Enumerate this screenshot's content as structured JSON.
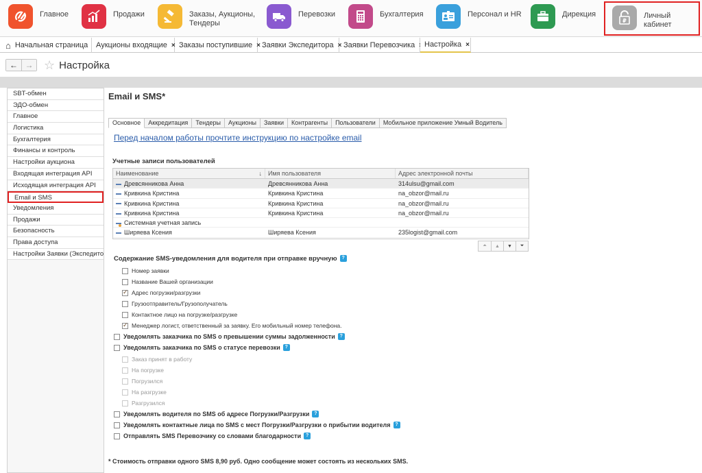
{
  "sections": [
    {
      "label": "Главное",
      "color": "#f0532d",
      "icon": "logo-icon"
    },
    {
      "label": "Продажи",
      "color": "#e03244",
      "icon": "sales-chart-icon"
    },
    {
      "label": "Заказы,  Аукционы,\nТендеры",
      "color": "#f5b935",
      "icon": "gavel-icon"
    },
    {
      "label": "Перевозки",
      "color": "#8a5ad0",
      "icon": "truck-icon"
    },
    {
      "label": "Бухгалтерия",
      "color": "#c24a8a",
      "icon": "calculator-icon"
    },
    {
      "label": "Персонал и HR",
      "color": "#3aa0dc",
      "icon": "id-card-icon"
    },
    {
      "label": "Дирекция",
      "color": "#2e9a52",
      "icon": "briefcase-icon"
    },
    {
      "label": "Личный кабинет",
      "color": "#999999",
      "icon": "lock-ruble-icon"
    }
  ],
  "open_tabs": [
    {
      "label": "Начальная страница"
    },
    {
      "label": "Аукционы входящие"
    },
    {
      "label": "Заказы поступившие"
    },
    {
      "label": "Заявки Экспедитора"
    },
    {
      "label": "Заявки Перевозчика"
    },
    {
      "label": "Настройка"
    }
  ],
  "page": {
    "title": "Настройка"
  },
  "sidebar": {
    "items": [
      {
        "label": "SBT-обмен"
      },
      {
        "label": "ЭДО-обмен"
      },
      {
        "label": "Главное"
      },
      {
        "label": "Логистика"
      },
      {
        "label": "Бухгалтерия"
      },
      {
        "label": "Финансы и контроль"
      },
      {
        "label": "Настройки аукциона"
      },
      {
        "label": "Входящая интеграция API"
      },
      {
        "label": "Исходящая интеграция API"
      },
      {
        "label": "Email и SMS"
      },
      {
        "label": "Уведомления"
      },
      {
        "label": "Продажи"
      },
      {
        "label": "Безопасность"
      },
      {
        "label": "Права доступа"
      },
      {
        "label": "Настройки Заявки (Экспедитора)"
      }
    ],
    "selected_index": 9
  },
  "main": {
    "heading": "Email и SMS*",
    "tabs": [
      {
        "label": "Основное"
      },
      {
        "label": "Аккредитация"
      },
      {
        "label": "Тендеры"
      },
      {
        "label": "Аукционы"
      },
      {
        "label": "Заявки"
      },
      {
        "label": "Контрагенты"
      },
      {
        "label": "Пользователи"
      },
      {
        "label": "Мобильное приложение Умный Водитель"
      }
    ],
    "intro_link": "Перед началом работы прочтите инструкцию по настройке email",
    "accounts_label": "Учетные записи пользователей",
    "table": {
      "columns": [
        "Наименование",
        "Имя пользователя",
        "Адрес электронной почты"
      ],
      "sort_indicator": "↓",
      "rows": [
        {
          "name": "Древсянникова Анна",
          "user": "Древсянникова Анна",
          "email": "314ulsu@gmail.com",
          "system": false
        },
        {
          "name": "Кривкина Кристина",
          "user": "Кривкина Кристина",
          "email": "na_obzor@mail.ru",
          "system": false
        },
        {
          "name": "Кривкина Кристина",
          "user": "Кривкина Кристина",
          "email": "na_obzor@mail.ru",
          "system": false
        },
        {
          "name": "Кривкина Кристина",
          "user": "Кривкина Кристина",
          "email": "na_obzor@mail.ru",
          "system": false
        },
        {
          "name": "Системная учетная запись",
          "user": "",
          "email": "",
          "system": true
        },
        {
          "name": "Ширяева Ксения",
          "user": "Ширяева Ксения",
          "email": "235logist@gmail.com",
          "system": false
        }
      ],
      "selected_row": 0
    },
    "sms_content_label": "Содержание SMS-уведомления для водителя при отправке вручную",
    "sms_options": [
      {
        "label": "Номер заявки",
        "checked": false
      },
      {
        "label": "Название Вашей организации",
        "checked": false
      },
      {
        "label": "Адрес погрузки/разгрузки",
        "checked": true
      },
      {
        "label": "Грузоотправитель/Грузополучатель",
        "checked": false
      },
      {
        "label": "Контактное лицо на погрузке/разгрузке",
        "checked": false
      },
      {
        "label": "Менеджер логист, ответственный за заявку. Его мобильный номер телефона.",
        "checked": true
      }
    ],
    "notify_debt": "Уведомлять заказчика по SMS о превышении суммы задолженности",
    "notify_status": "Уведомлять заказчика по SMS о статусе перевозки",
    "status_options": [
      {
        "label": "Заказ принят в работу"
      },
      {
        "label": "На погрузке"
      },
      {
        "label": "Погрузился"
      },
      {
        "label": "На разгрузке"
      },
      {
        "label": "Разгрузился"
      }
    ],
    "notify_driver": "Уведомлять водителя по SMS об адресе Погрузки/Разгрузки",
    "notify_contacts": "Уведомлять контактные лица по SMS с мест Погрузки/Разгрузки о прибытии водителя",
    "thank_carrier": "Отправлять SMS Перевозчику со словами благодарности",
    "help_glyph": "?",
    "footnote": "* Стоимость отправки одного SMS 8,90 руб. Одно сообщение может состоять из нескольких SMS."
  },
  "nav": {
    "back": "←",
    "forward": "→",
    "star": "☆",
    "close": "×",
    "home": "⌂"
  },
  "scroll": {
    "first": "⏶",
    "up": "▲",
    "down": "▼",
    "last": "⏷"
  }
}
